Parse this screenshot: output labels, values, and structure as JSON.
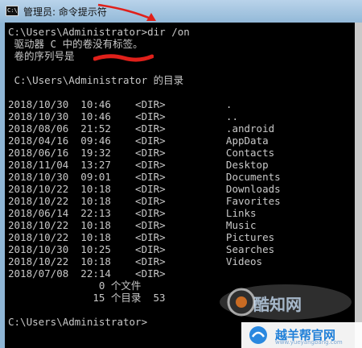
{
  "window": {
    "title": "管理员: 命令提示符",
    "icon": "cmd-window-icon",
    "icon_glyph": "C:\\"
  },
  "console": {
    "lines": [
      "C:\\Users\\Administrator>dir /on",
      " 驱动器 C 中的卷没有标签。",
      " 卷的序列号是",
      "",
      " C:\\Users\\Administrator 的目录",
      "",
      "2018/10/30  10:46    <DIR>          .",
      "2018/10/30  10:46    <DIR>          ..",
      "2018/08/06  21:52    <DIR>          .android",
      "2018/04/16  09:46    <DIR>          AppData",
      "2018/06/16  19:32    <DIR>          Contacts",
      "2018/11/04  13:27    <DIR>          Desktop",
      "2018/10/30  09:01    <DIR>          Documents",
      "2018/10/22  10:18    <DIR>          Downloads",
      "2018/10/22  10:18    <DIR>          Favorites",
      "2018/06/14  22:13    <DIR>          Links",
      "2018/10/22  10:18    <DIR>          Music",
      "2018/10/22  10:18    <DIR>          Pictures",
      "2018/10/30  10:25    <DIR>          Searches",
      "2018/10/22  10:18    <DIR>          Videos",
      "2018/07/08  22:14    <DIR>",
      "               0 个文件",
      "              15 个目录  53",
      "",
      "C:\\Users\\Administrator>"
    ],
    "text_color": "#c8c8c8",
    "background": "#000000"
  },
  "annotation": {
    "color": "#e0201a"
  },
  "watermarks": {
    "main_text": "酷知网",
    "site_text": "越羊帮官网",
    "site_url": "www.yueyangbang.com"
  }
}
